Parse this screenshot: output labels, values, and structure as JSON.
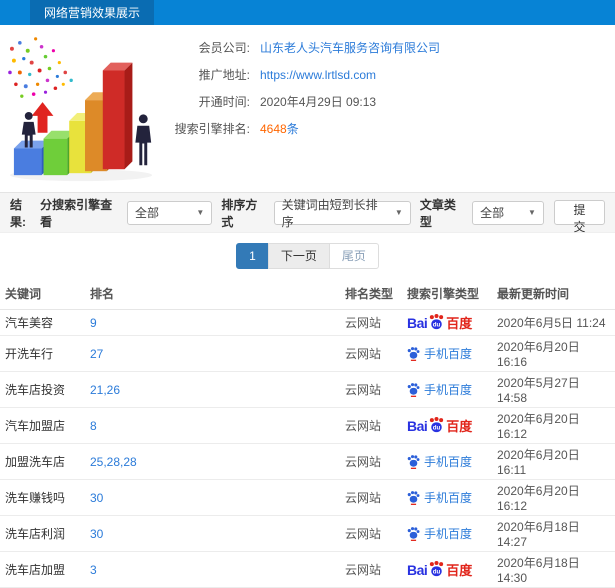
{
  "header": {
    "title": "网络营销效果展示"
  },
  "info": {
    "member_label": "会员公司:",
    "member_value": "山东老人头汽车服务咨询有限公司",
    "url_label": "推广地址:",
    "url_value": "https://www.lrtlsd.com",
    "open_label": "开通时间:",
    "open_value": "2020年4月29日 09:13",
    "rank_label": "搜索引擎排名:",
    "rank_count": "4648",
    "rank_unit": "条"
  },
  "filters": {
    "result_label": "结果:",
    "engine_label": "分搜索引擎查看",
    "engine_value": "全部",
    "sort_label": "排序方式",
    "sort_value": "关键词由短到长排序",
    "article_label": "文章类型",
    "article_value": "全部",
    "submit_label": "提交"
  },
  "pagination": {
    "current": "1",
    "next_label": "下一页",
    "last_label": "尾页"
  },
  "table": {
    "headers": [
      "关键词",
      "排名",
      "排名类型",
      "搜索引擎类型",
      "最新更新时间"
    ],
    "rows": [
      {
        "keyword": "汽车美容",
        "rank": "9",
        "rank_type": "云网站",
        "engine": "baidu",
        "updated": "2020年6月5日 11:24"
      },
      {
        "keyword": "开洗车行",
        "rank": "27",
        "rank_type": "云网站",
        "engine": "mobile-baidu",
        "updated": "2020年6月20日 16:16"
      },
      {
        "keyword": "洗车店投资",
        "rank": "21,26",
        "rank_type": "云网站",
        "engine": "mobile-baidu",
        "updated": "2020年5月27日 14:58"
      },
      {
        "keyword": "汽车加盟店",
        "rank": "8",
        "rank_type": "云网站",
        "engine": "baidu",
        "updated": "2020年6月20日 16:12"
      },
      {
        "keyword": "加盟洗车店",
        "rank": "25,28,28",
        "rank_type": "云网站",
        "engine": "mobile-baidu",
        "updated": "2020年6月20日 16:11"
      },
      {
        "keyword": "洗车赚钱吗",
        "rank": "30",
        "rank_type": "云网站",
        "engine": "mobile-baidu",
        "updated": "2020年6月20日 16:12"
      },
      {
        "keyword": "洗车店利润",
        "rank": "30",
        "rank_type": "云网站",
        "engine": "mobile-baidu",
        "updated": "2020年6月18日 14:27"
      },
      {
        "keyword": "洗车店加盟",
        "rank": "3",
        "rank_type": "云网站",
        "engine": "baidu",
        "updated": "2020年6月18日 14:30"
      }
    ]
  },
  "engine_logos": {
    "baidu_bai": "Bai",
    "baidu_du": "du",
    "baidu_cn": "百度",
    "mobile_label": "手机百度"
  },
  "colors": {
    "topbar_blue": "#0783d5",
    "topbar_tab_blue": "#0a6cb2",
    "link_blue": "#2b7bd9",
    "highlight_orange": "#ff6600",
    "pagination_active_blue": "#337ab7",
    "baidu_blue": "#2932e1",
    "baidu_red": "#e1251b"
  }
}
